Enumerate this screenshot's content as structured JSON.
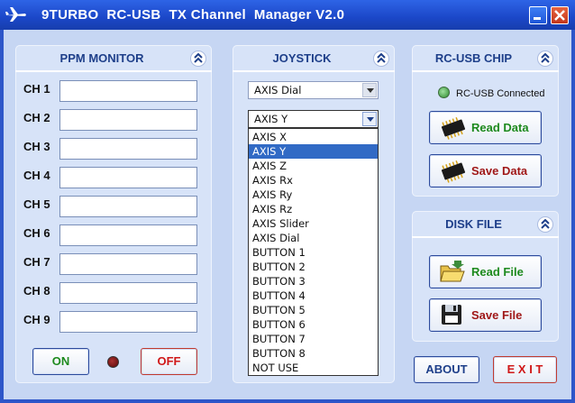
{
  "window": {
    "title": "9TURBO  RC-USB  TX Channel  Manager V2.0"
  },
  "ppm_monitor": {
    "title": "PPM MONITOR",
    "channels": [
      {
        "label": "CH 1",
        "value": ""
      },
      {
        "label": "CH 2",
        "value": ""
      },
      {
        "label": "CH 3",
        "value": ""
      },
      {
        "label": "CH 4",
        "value": ""
      },
      {
        "label": "CH 5",
        "value": ""
      },
      {
        "label": "CH 6",
        "value": ""
      },
      {
        "label": "CH 7",
        "value": ""
      },
      {
        "label": "CH 8",
        "value": ""
      },
      {
        "label": "CH 9",
        "value": ""
      }
    ],
    "on_label": "ON",
    "off_label": "OFF"
  },
  "joystick": {
    "title": "JOYSTICK",
    "combo1_value": "AXIS Dial",
    "combo2_value": "AXIS Y",
    "options": [
      "AXIS X",
      "AXIS Y",
      "AXIS Z",
      "AXIS Rx",
      "AXIS Ry",
      "AXIS Rz",
      "AXIS Slider",
      "AXIS Dial",
      "BUTTON 1",
      "BUTTON 2",
      "BUTTON 3",
      "BUTTON 4",
      "BUTTON 5",
      "BUTTON 6",
      "BUTTON 7",
      "BUTTON 8",
      "NOT USE"
    ],
    "selected_index": 1
  },
  "rc_usb_chip": {
    "title": "RC-USB  CHIP",
    "status": "RC-USB Connected",
    "read_label": "Read Data",
    "save_label": "Save Data"
  },
  "disk_file": {
    "title": "DISK FILE",
    "read_label": "Read File",
    "save_label": "Save File"
  },
  "about_label": "ABOUT",
  "exit_label": "E X I T",
  "colors": {
    "title_bar": "#1b47c8",
    "panel_bg": "#d7e3f8",
    "panel_title": "#1e3f8a",
    "green_text": "#1e8a1e",
    "red_text": "#d01818",
    "about_text": "#1e3f8a",
    "selection": "#316ac5",
    "led_connected": "#3aa83a",
    "led_off": "#7a1010"
  },
  "icons": {
    "app": "airplane-icon",
    "collapse": "chevron-up-icon",
    "chip": "chip-icon",
    "folder": "folder-icon",
    "disk": "floppy-disk-icon"
  }
}
